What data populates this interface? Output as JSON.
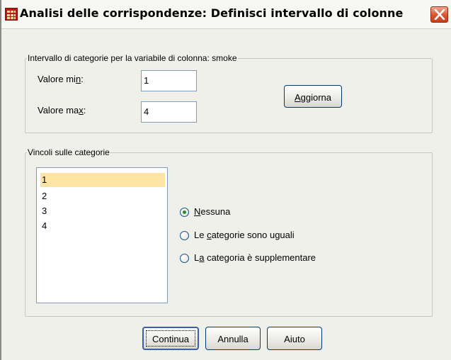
{
  "window": {
    "title": "Analisi delle corrispondenze: Definisci intervallo di colonne",
    "icon": "table-grid-icon",
    "close_icon": "close-x-icon",
    "accent": "#d8552f"
  },
  "range_group": {
    "label": "Intervallo di categorie per la variabile di colonna:  smoke",
    "min_label": "Valore min:",
    "min_value": "1",
    "max_label": "Valore max:",
    "max_value": "4",
    "update_button": "Aggiorna"
  },
  "constraints_group": {
    "label": "Vincoli sulle categorie",
    "categories": [
      "1",
      "2",
      "3",
      "4"
    ],
    "selected_category": "1",
    "options": [
      {
        "label": "Nessuna",
        "checked": true
      },
      {
        "label": "Le categorie sono uguali",
        "checked": false
      },
      {
        "label": "La categoria è supplementare",
        "checked": false
      }
    ]
  },
  "buttons": {
    "continue": "Continua",
    "cancel": "Annulla",
    "help": "Aiuto"
  }
}
